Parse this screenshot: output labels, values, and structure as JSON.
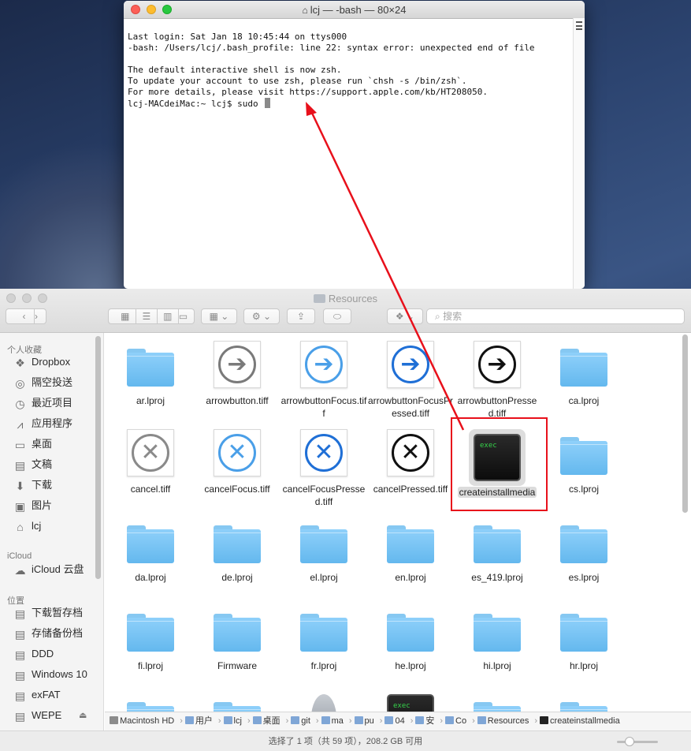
{
  "terminal": {
    "title": "lcj — -bash — 80×24",
    "lines": [
      "Last login: Sat Jan 18 10:45:44 on ttys000",
      "-bash: /Users/lcj/.bash_profile: line 22: syntax error: unexpected end of file",
      "",
      "The default interactive shell is now zsh.",
      "To update your account to use zsh, please run `chsh -s /bin/zsh`.",
      "For more details, please visit https://support.apple.com/kb/HT208050.",
      "lcj-MACdeiMac:~ lcj$ sudo "
    ]
  },
  "finder": {
    "title": "Resources",
    "search_placeholder": "搜索",
    "sidebar": {
      "favorites_header": "个人收藏",
      "favorites": [
        {
          "label": "Dropbox",
          "icon": "dropbox-icon"
        },
        {
          "label": "隔空投送",
          "icon": "airdrop-icon"
        },
        {
          "label": "最近项目",
          "icon": "recents-icon"
        },
        {
          "label": "应用程序",
          "icon": "applications-icon"
        },
        {
          "label": "桌面",
          "icon": "desktop-icon"
        },
        {
          "label": "文稿",
          "icon": "documents-icon"
        },
        {
          "label": "下载",
          "icon": "downloads-icon"
        },
        {
          "label": "图片",
          "icon": "pictures-icon"
        },
        {
          "label": "lcj",
          "icon": "home-icon"
        }
      ],
      "icloud_header": "iCloud",
      "icloud": [
        {
          "label": "iCloud 云盘",
          "icon": "cloud-icon"
        }
      ],
      "locations_header": "位置",
      "locations": [
        {
          "label": "下载暂存档",
          "icon": "disk-icon"
        },
        {
          "label": "存储备份档",
          "icon": "disk-icon"
        },
        {
          "label": "DDD",
          "icon": "disk-icon"
        },
        {
          "label": "Windows 10",
          "icon": "disk-icon"
        },
        {
          "label": "exFAT",
          "icon": "disk-icon"
        },
        {
          "label": "WEPE",
          "icon": "disk-icon",
          "eject": "⏏"
        }
      ]
    },
    "items": [
      {
        "name": "ar.lproj",
        "kind": "folder"
      },
      {
        "name": "arrowbutton.tiff",
        "kind": "arrow",
        "color": "#7a7a7a",
        "fill": "#ffffff"
      },
      {
        "name": "arrowbuttonFocus.tiff",
        "kind": "arrow",
        "color": "#4a9fe8",
        "fill": "#ffffff"
      },
      {
        "name": "arrowbuttonFocusPressed.tiff",
        "kind": "arrow",
        "color": "#1f6fd6",
        "fill": "#ffffff"
      },
      {
        "name": "arrowbuttonPressed.tiff",
        "kind": "arrow",
        "color": "#111111",
        "fill": "#ffffff"
      },
      {
        "name": "ca.lproj",
        "kind": "folder"
      },
      {
        "name": "cancel.tiff",
        "kind": "cancel",
        "color": "#8a8a8a"
      },
      {
        "name": "cancelFocus.tiff",
        "kind": "cancel",
        "color": "#4a9fe8"
      },
      {
        "name": "cancelFocusPressed.tiff",
        "kind": "cancel",
        "color": "#1f6fd6"
      },
      {
        "name": "cancelPressed.tiff",
        "kind": "cancel",
        "color": "#111111"
      },
      {
        "name": "createinstallmedia",
        "kind": "exec",
        "selected": true
      },
      {
        "name": "cs.lproj",
        "kind": "folder"
      },
      {
        "name": "da.lproj",
        "kind": "folder"
      },
      {
        "name": "de.lproj",
        "kind": "folder"
      },
      {
        "name": "el.lproj",
        "kind": "folder"
      },
      {
        "name": "en.lproj",
        "kind": "folder"
      },
      {
        "name": "es_419.lproj",
        "kind": "folder"
      },
      {
        "name": "es.lproj",
        "kind": "folder"
      },
      {
        "name": "fi.lproj",
        "kind": "folder"
      },
      {
        "name": "Firmware",
        "kind": "folder"
      },
      {
        "name": "fr.lproj",
        "kind": "folder"
      },
      {
        "name": "he.lproj",
        "kind": "folder"
      },
      {
        "name": "hi.lproj",
        "kind": "folder"
      },
      {
        "name": "hr.lproj",
        "kind": "folder"
      },
      {
        "name": "",
        "kind": "folder"
      },
      {
        "name": "",
        "kind": "folder"
      },
      {
        "name": "",
        "kind": "installer"
      },
      {
        "name": "",
        "kind": "exec-small"
      },
      {
        "name": "",
        "kind": "folder"
      },
      {
        "name": "",
        "kind": "folder"
      }
    ],
    "exec_label": "exec",
    "path": [
      "Macintosh HD",
      "用户",
      "lcj",
      "桌面",
      "git",
      "ma",
      "pu",
      "04",
      "安",
      "Co",
      "Resources",
      "createinstallmedia"
    ],
    "path_sep": "›",
    "status": "选择了 1 项（共 59 项），208.2 GB 可用"
  },
  "colors": {
    "annotation_red": "#e8101b"
  }
}
